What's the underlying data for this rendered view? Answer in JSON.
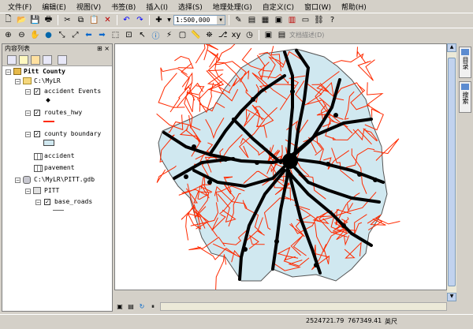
{
  "menu": [
    "文件(F)",
    "编辑(E)",
    "视图(V)",
    "书签(B)",
    "插入(I)",
    "选择(S)",
    "地理处理(G)",
    "自定义(C)",
    "窗口(W)",
    "帮助(H)"
  ],
  "toolbar": {
    "scale_value": "1:500,000",
    "text_description_label": "文档描述(D)"
  },
  "toc": {
    "title": "内容列表",
    "pin": "⊞ ×",
    "items": {
      "root": "Pitt County",
      "folder": "C:\\MyLR",
      "layer1": "accident Events",
      "layer2": "routes_hwy",
      "layer3": "county boundary",
      "table1": "accident",
      "table2": "pavement",
      "gdb": "C:\\MyLR\\PITT.gdb",
      "dataset": "PITT",
      "layer4": "base_roads"
    }
  },
  "right_panel": {
    "tab1": "目录",
    "tab2": "搜索"
  },
  "status": {
    "x": "2524721.79",
    "y": "767349.41",
    "units": "英尺"
  },
  "colors": {
    "roads": "#ff2a00",
    "routes": "#000000",
    "county_fill": "#d0e8f0"
  }
}
